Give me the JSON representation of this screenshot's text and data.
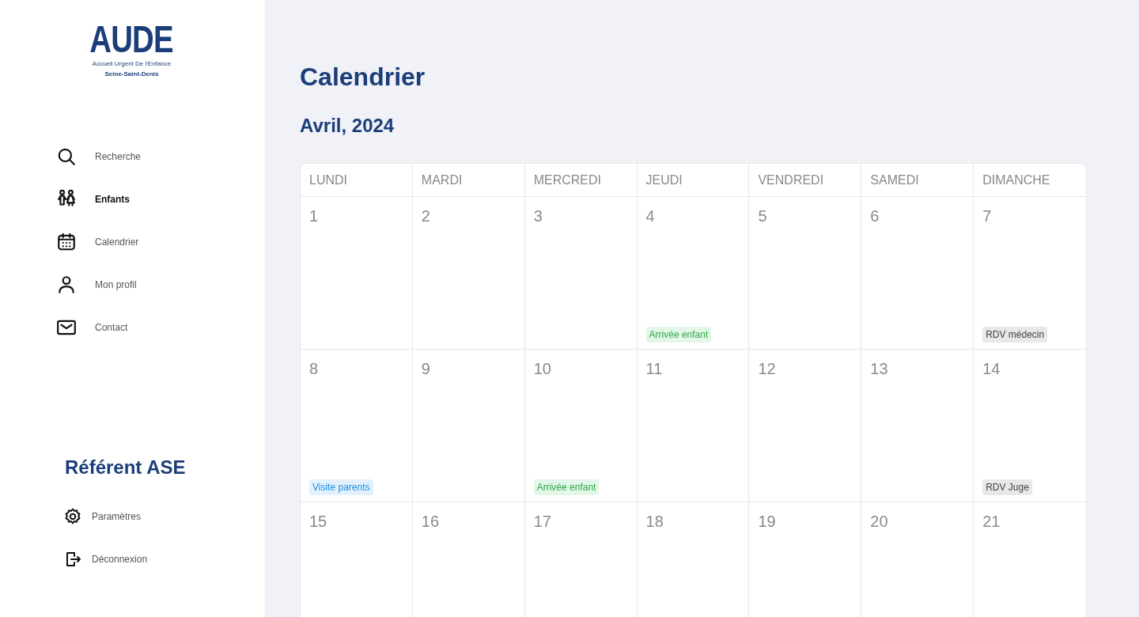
{
  "logo": {
    "wordmark": "AUDE",
    "subtitle": "Accueil Urgent De l'Enfance",
    "department": "Seine-Saint-Denis"
  },
  "nav": [
    {
      "label": "Recherche",
      "selected": false
    },
    {
      "label": "Enfants",
      "selected": true
    },
    {
      "label": "Calendrier",
      "selected": false
    },
    {
      "label": "Mon profil",
      "selected": false
    },
    {
      "label": "Contact",
      "selected": false
    }
  ],
  "role": "Référent ASE",
  "footer_nav": [
    {
      "label": "Paramètres"
    },
    {
      "label": "Déconnexion"
    }
  ],
  "page_title": "Calendrier",
  "month": "Avril, 2024",
  "weekdays": [
    "LUNDI",
    "MARDI",
    "MERCREDI",
    "JEUDI",
    "VENDREDI",
    "SAMEDI",
    "DIMANCHE"
  ],
  "weeks": [
    [
      {
        "day": "1"
      },
      {
        "day": "2"
      },
      {
        "day": "3"
      },
      {
        "day": "4",
        "events": [
          {
            "label": "Arrivée enfant",
            "kind": "arrival"
          }
        ]
      },
      {
        "day": "5"
      },
      {
        "day": "6"
      },
      {
        "day": "7",
        "events": [
          {
            "label": "RDV médecin",
            "kind": "appointment"
          }
        ]
      }
    ],
    [
      {
        "day": "8",
        "events": [
          {
            "label": "Visite parents",
            "kind": "visit"
          }
        ]
      },
      {
        "day": "9"
      },
      {
        "day": "10",
        "events": [
          {
            "label": "Arrivée enfant",
            "kind": "arrival"
          }
        ]
      },
      {
        "day": "11"
      },
      {
        "day": "12"
      },
      {
        "day": "13"
      },
      {
        "day": "14",
        "events": [
          {
            "label": "RDV Juge",
            "kind": "appointment"
          }
        ]
      }
    ],
    [
      {
        "day": "15"
      },
      {
        "day": "16"
      },
      {
        "day": "17"
      },
      {
        "day": "18"
      },
      {
        "day": "19"
      },
      {
        "day": "20"
      },
      {
        "day": "21"
      }
    ]
  ]
}
